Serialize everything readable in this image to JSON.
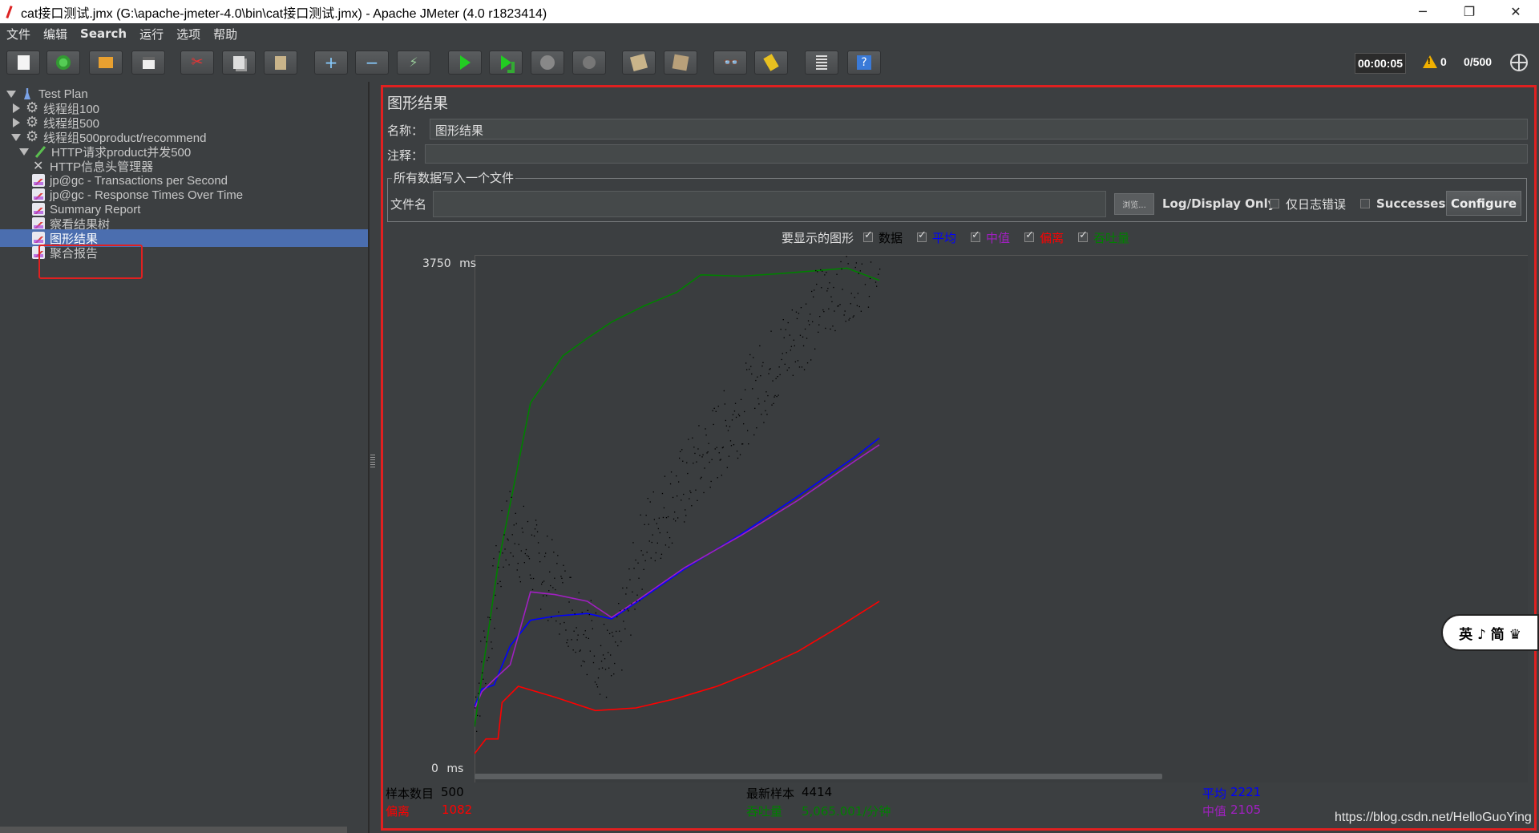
{
  "window": {
    "title": "cat接口测试.jmx (G:\\apache-jmeter-4.0\\bin\\cat接口测试.jmx) - Apache JMeter (4.0 r1823414)",
    "min_glyph": "─",
    "max_glyph": "❐",
    "close_glyph": "✕"
  },
  "menu": [
    "文件",
    "编辑",
    "Search",
    "运行",
    "选项",
    "帮助"
  ],
  "toolbar": {
    "buttons": [
      "new-icon",
      "templates-icon",
      "open-icon",
      "save-icon",
      "cut-icon",
      "copy-icon",
      "paste-icon",
      "expand-icon",
      "collapse-icon",
      "toggle-icon",
      "start-icon",
      "start-no-pause-icon",
      "stop-icon",
      "shutdown-icon",
      "clear-icon",
      "clear-all-icon",
      "search-icon",
      "reset-search-icon",
      "function-helper-icon",
      "help-icon"
    ],
    "timer": "00:00:05",
    "warnings": "0",
    "threads": "0/500"
  },
  "tree": [
    {
      "label": "Test Plan",
      "icon": "flask",
      "arrow": "open"
    },
    {
      "label": "线程组100",
      "icon": "gear",
      "arrow": "closed"
    },
    {
      "label": "线程组500",
      "icon": "gear",
      "arrow": "closed"
    },
    {
      "label": "线程组500product/recommend",
      "icon": "gear",
      "arrow": "open"
    },
    {
      "label": "HTTP请求product并发500",
      "icon": "pen",
      "arrow": "open"
    },
    {
      "label": "HTTP信息头管理器",
      "icon": "tools",
      "arrow": ""
    },
    {
      "label": "jp@gc - Transactions per Second",
      "icon": "graph",
      "arrow": ""
    },
    {
      "label": "jp@gc - Response Times Over Time",
      "icon": "graph",
      "arrow": ""
    },
    {
      "label": "Summary Report",
      "icon": "graph",
      "arrow": ""
    },
    {
      "label": "察看结果树",
      "icon": "graph",
      "arrow": ""
    },
    {
      "label": "图形结果",
      "icon": "graph",
      "arrow": "",
      "selected": true
    },
    {
      "label": "聚合报告",
      "icon": "graph",
      "arrow": ""
    }
  ],
  "panel": {
    "title": "图形结果",
    "name_label": "名称：",
    "name_value": "图形结果",
    "comment_label": "注释：",
    "comment_value": "",
    "fieldset_legend": "所有数据写入一个文件",
    "filename_label": "文件名",
    "filename_value": "",
    "browse_label": "浏览...",
    "log_display_label": "Log/Display Only:",
    "errors_label": "仅日志错误",
    "successes_label": "Successes",
    "configure_label": "Configure"
  },
  "graph": {
    "legend_title": "要显示的图形",
    "legend_items": [
      {
        "label": "数据",
        "color": "#000000"
      },
      {
        "label": "平均",
        "color": "#0000ff"
      },
      {
        "label": "中值",
        "color": "#a020c0"
      },
      {
        "label": "偏离",
        "color": "#ff0000"
      },
      {
        "label": "吞吐量",
        "color": "#008000"
      }
    ]
  },
  "chart_data": {
    "type": "line",
    "y_top_label": "3750",
    "y_bottom_label": "0",
    "y_unit": "ms",
    "ylim": [
      0,
      3750
    ],
    "x_samples": [
      1,
      500
    ],
    "series": [
      {
        "name": "平均",
        "color": "#0000ff",
        "x": [
          1,
          10,
          25,
          45,
          70,
          100,
          140,
          170,
          200,
          260,
          330,
          400,
          470,
          500
        ],
        "y": [
          450,
          580,
          610,
          900,
          1090,
          1120,
          1140,
          1100,
          1220,
          1470,
          1730,
          2010,
          2300,
          2440
        ]
      },
      {
        "name": "中值",
        "color": "#a020c0",
        "x": [
          1,
          10,
          25,
          45,
          70,
          100,
          140,
          170,
          200,
          260,
          330,
          400,
          470,
          500
        ],
        "y": [
          430,
          560,
          650,
          760,
          1300,
          1280,
          1230,
          1110,
          1230,
          1480,
          1720,
          1980,
          2270,
          2390
        ]
      },
      {
        "name": "偏离",
        "color": "#ff0000",
        "x": [
          1,
          15,
          30,
          35,
          55,
          100,
          150,
          200,
          250,
          300,
          350,
          400,
          450,
          500
        ],
        "y": [
          100,
          210,
          210,
          480,
          600,
          520,
          420,
          440,
          510,
          600,
          720,
          860,
          1040,
          1230
        ]
      },
      {
        "name": "吞吐量",
        "color": "#008000",
        "x": [
          1,
          30,
          70,
          110,
          140,
          170,
          210,
          250,
          280,
          330,
          380,
          420,
          460,
          500
        ],
        "y": [
          300,
          1500,
          2700,
          3050,
          3180,
          3300,
          3420,
          3520,
          3650,
          3640,
          3660,
          3680,
          3700,
          3610
        ]
      },
      {
        "name": "数据",
        "color": "#000000",
        "trend_x": [
          1,
          40,
          80,
          130,
          170,
          210,
          260,
          310,
          360,
          410,
          450,
          480,
          500
        ],
        "trend_y": [
          450,
          1800,
          1500,
          1100,
          700,
          1700,
          2100,
          2500,
          2900,
          3300,
          3600,
          3700,
          3800
        ]
      }
    ]
  },
  "stats": {
    "samples_label": "样本数目",
    "samples_value": "500",
    "latest_label": "最新样本",
    "latest_value": "4414",
    "average_label": "平均",
    "average_value": "2221",
    "deviation_label": "偏离",
    "deviation_value": "1082",
    "throughput_label": "吞吐量",
    "throughput_value": "5,065.001/分钟",
    "median_label": "中值",
    "median_value": "2105"
  },
  "float_widget": "英 ♪ 简 ♛",
  "watermark": "https://blog.csdn.net/HelloGuoYing"
}
